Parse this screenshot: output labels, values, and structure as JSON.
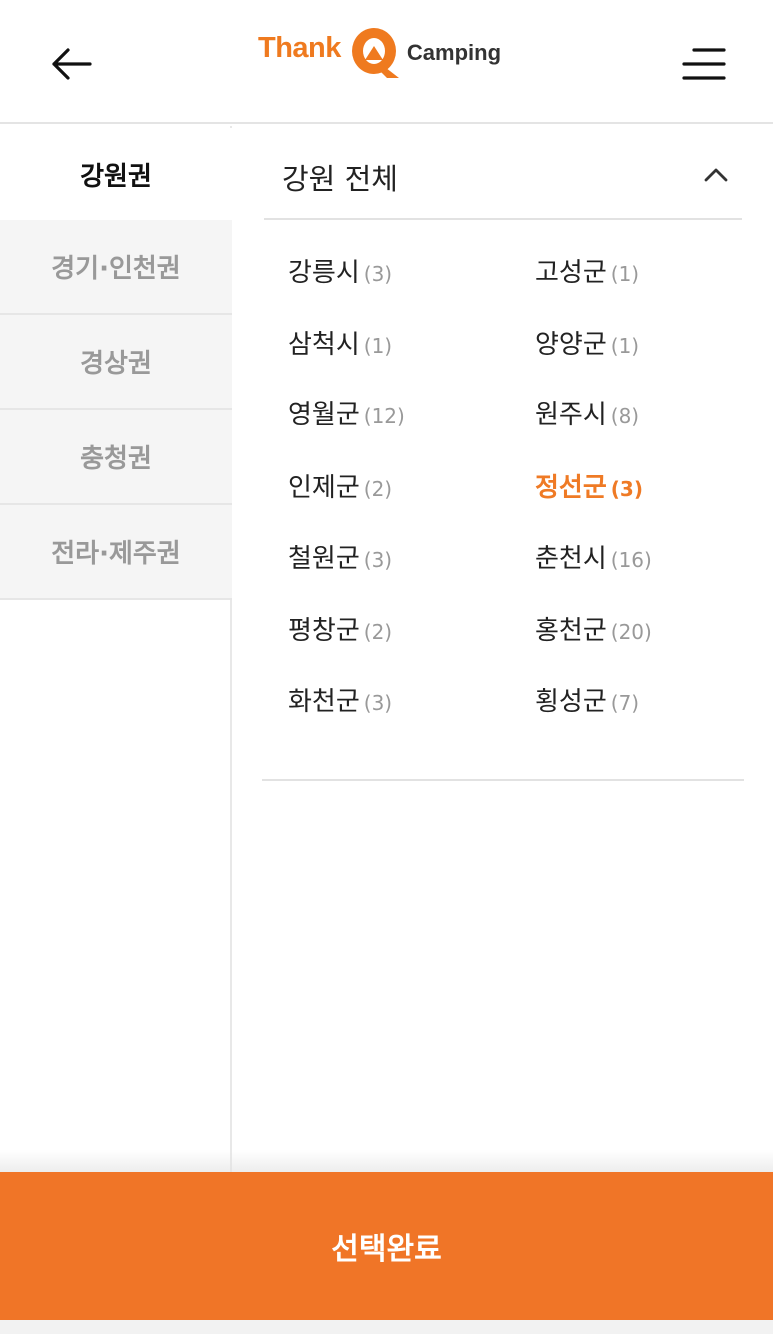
{
  "header": {
    "logo_thank": "Thank",
    "logo_camping": "Camping"
  },
  "sidebar": {
    "items": [
      {
        "label": "강원권",
        "active": true
      },
      {
        "label": "경기·인천권",
        "active": false
      },
      {
        "label": "경상권",
        "active": false
      },
      {
        "label": "충청권",
        "active": false
      },
      {
        "label": "전라·제주권",
        "active": false
      }
    ]
  },
  "panel": {
    "title": "강원 전체",
    "regions": [
      {
        "name": "강릉시",
        "count": "(3)"
      },
      {
        "name": "고성군",
        "count": "(1)"
      },
      {
        "name": "삼척시",
        "count": "(1)"
      },
      {
        "name": "양양군",
        "count": "(1)"
      },
      {
        "name": "영월군",
        "count": "(12)"
      },
      {
        "name": "원주시",
        "count": "(8)"
      },
      {
        "name": "인제군",
        "count": "(2)"
      },
      {
        "name": "정선군",
        "count": "(3)",
        "selected": true
      },
      {
        "name": "철원군",
        "count": "(3)"
      },
      {
        "name": "춘천시",
        "count": "(16)"
      },
      {
        "name": "평창군",
        "count": "(2)"
      },
      {
        "name": "홍천군",
        "count": "(20)"
      },
      {
        "name": "화천군",
        "count": "(3)"
      },
      {
        "name": "횡성군",
        "count": "(7)"
      }
    ]
  },
  "footer": {
    "confirm_label": "선택완료"
  },
  "colors": {
    "accent": "#f07527",
    "brand": "#ef7a1f"
  }
}
